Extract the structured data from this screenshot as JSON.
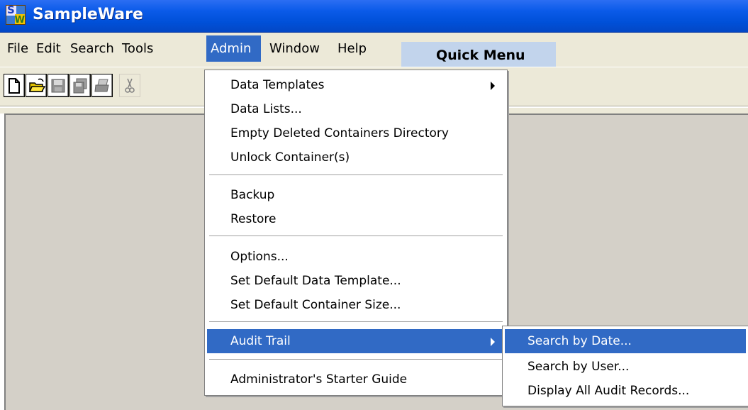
{
  "window": {
    "title": "SampleWare",
    "icon": "sampleware-app-icon",
    "icon_letters": [
      "S",
      "W"
    ]
  },
  "menubar": {
    "items": [
      {
        "label": "File"
      },
      {
        "label": "Edit"
      },
      {
        "label": "Search"
      },
      {
        "label": "Tools"
      },
      {
        "label": "Admin",
        "active": true
      },
      {
        "label": "Window"
      },
      {
        "label": "Help"
      }
    ],
    "quick_menu": "Quick Menu"
  },
  "toolbar": {
    "buttons": [
      {
        "icon": "new-document-icon"
      },
      {
        "icon": "open-folder-icon"
      },
      {
        "icon": "save-icon"
      },
      {
        "icon": "save-all-icon"
      },
      {
        "icon": "print-icon"
      },
      {
        "icon": "cut-icon"
      }
    ]
  },
  "admin_menu": {
    "groups": [
      {
        "items": [
          {
            "label": "Data Templates",
            "has_submenu": true
          },
          {
            "label": "Data Lists..."
          },
          {
            "label": "Empty Deleted Containers Directory"
          },
          {
            "label": "Unlock Container(s)"
          }
        ]
      },
      {
        "items": [
          {
            "label": "Backup"
          },
          {
            "label": "Restore"
          }
        ]
      },
      {
        "items": [
          {
            "label": "Options..."
          },
          {
            "label": "Set Default Data Template..."
          },
          {
            "label": "Set Default Container Size..."
          }
        ]
      },
      {
        "items": [
          {
            "label": "Audit Trail",
            "has_submenu": true,
            "highlighted": true
          }
        ]
      },
      {
        "items": [
          {
            "label": "Administrator's Starter Guide"
          }
        ]
      }
    ]
  },
  "audit_trail_submenu": {
    "items": [
      {
        "label": "Search by Date...",
        "highlighted": true
      },
      {
        "label": "Search by User..."
      },
      {
        "label": "Display All Audit Records..."
      }
    ]
  },
  "colors": {
    "titlebar": "#0a5ae8",
    "highlight": "#316ac5",
    "menu_bg": "#ece9d8",
    "quick_menu_bg": "#c2d4ec",
    "client_bg": "#d4d0c8"
  }
}
